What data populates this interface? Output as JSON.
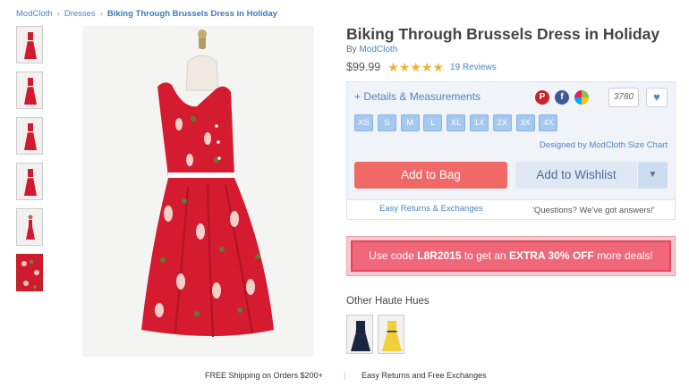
{
  "breadcrumb": {
    "home": "ModCloth",
    "category": "Dresses",
    "current": "Biking Through Brussels Dress in Holiday"
  },
  "product": {
    "title": "Biking Through Brussels Dress in Holiday",
    "by_prefix": "By",
    "brand": "ModCloth",
    "price": "$99.99",
    "rating": 5,
    "reviews": "19 Reviews"
  },
  "details_link": "+ Details & Measurements",
  "fav_count": "3780",
  "sizes": [
    "XS",
    "S",
    "M",
    "L",
    "XL",
    "1X",
    "2X",
    "3X",
    "4X"
  ],
  "size_chart": "Designed by ModCloth Size Chart",
  "buttons": {
    "add_to_bag": "Add to Bag",
    "add_to_wishlist": "Add to Wishlist"
  },
  "help": {
    "returns": "Easy Returns & Exchanges",
    "questions": "'Questions? We've got answers!'"
  },
  "promo": {
    "prefix": "Use code",
    "code": "L8R2015",
    "middle": "to get an",
    "offer": "EXTRA 30% OFF",
    "suffix": "more deals!"
  },
  "other_hues": {
    "title": "Other Haute Hues",
    "items": [
      "navy",
      "yellow"
    ]
  },
  "footer": {
    "shipping": "FREE Shipping on Orders $200+",
    "divider": "|",
    "returns": "Easy Returns and Free Exchanges"
  },
  "colors": {
    "link": "#4a86c5",
    "size_button": "#a5c8f1",
    "add_to_bag": "#f06966",
    "promo": "#f0677a",
    "dress_red": "#d01a2e",
    "star": "#f2b233"
  },
  "icons": [
    "pinterest-icon",
    "facebook-icon",
    "color-wheel-icon",
    "heart-icon",
    "chevron-down-icon"
  ]
}
